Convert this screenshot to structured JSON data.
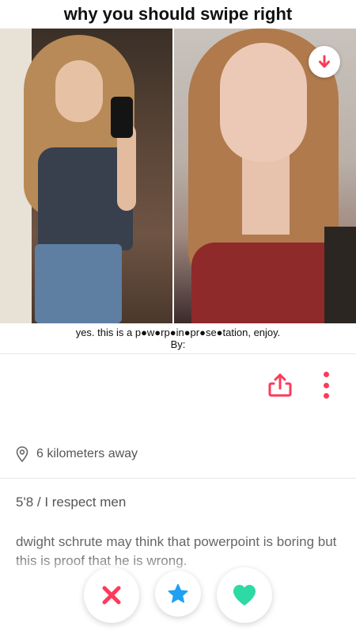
{
  "slide_title": "why you should swipe right",
  "caption": {
    "line1": "yes. this is a p●w●rp●in●pr●se●tation, enjoy.",
    "line2": "By:"
  },
  "profile": {
    "distance": "6 kilometers away",
    "height_line": "5'8 / I respect men",
    "bio": "dwight schrute may think that powerpoint is boring but this is proof that he is wrong."
  },
  "icons": {
    "rewind": "arrow-down-icon",
    "share": "share-icon",
    "more": "more-vertical-icon",
    "location": "location-pin-icon",
    "nope": "x-icon",
    "super_like": "star-icon",
    "like": "heart-icon"
  },
  "colors": {
    "accent": "#fd3a5a",
    "nope": "#fd3a5a",
    "super_like": "#1ea1f2",
    "like": "#2dd9a4",
    "text_muted": "#666666"
  }
}
